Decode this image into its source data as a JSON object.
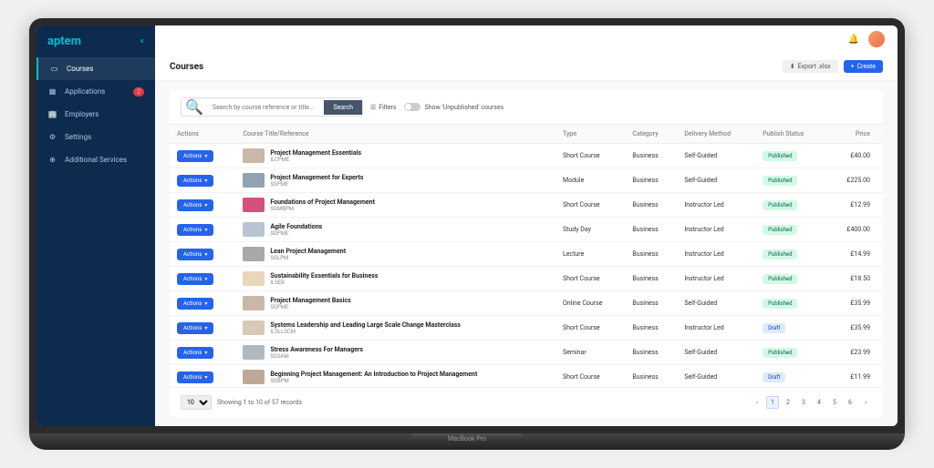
{
  "brand": "aptem",
  "sidebar": {
    "items": [
      {
        "label": "Courses",
        "active": true
      },
      {
        "label": "Applications",
        "badge": "2"
      },
      {
        "label": "Employers"
      },
      {
        "label": "Settings"
      },
      {
        "label": "Additional Services"
      }
    ]
  },
  "page": {
    "title": "Courses",
    "export_label": "Export .xlsx",
    "create_label": "Create"
  },
  "search": {
    "placeholder": "Search by course reference or title...",
    "button": "Search",
    "filters_label": "Filters",
    "toggle_label": "Show 'Unpublished' courses"
  },
  "table": {
    "headers": {
      "actions": "Actions",
      "title": "Course Title/Reference",
      "type": "Type",
      "category": "Category",
      "delivery": "Delivery Method",
      "status": "Publish Status",
      "price": "Price"
    },
    "action_btn": "Actions",
    "rows": [
      {
        "title": "Project Management Essentials",
        "ref": "ILCPME",
        "type": "Short Course",
        "category": "Business",
        "delivery": "Self-Guided",
        "status": "Published",
        "price": "£40.00",
        "thumb": "#c9b8a8"
      },
      {
        "title": "Project Management for Experts",
        "ref": "SGPME",
        "type": "Module",
        "category": "Business",
        "delivery": "Self-Guided",
        "status": "Published",
        "price": "£225.00",
        "thumb": "#8fa3b0"
      },
      {
        "title": "Foundations of Project Management",
        "ref": "SGMBPM",
        "type": "Short Course",
        "category": "Business",
        "delivery": "Instructor Led",
        "status": "Published",
        "price": "£12.99",
        "thumb": "#d4527a"
      },
      {
        "title": "Agile Foundations",
        "ref": "SGPME",
        "type": "Study Day",
        "category": "Business",
        "delivery": "Instructor Led",
        "status": "Published",
        "price": "£400.00",
        "thumb": "#b8c4d0"
      },
      {
        "title": "Lean Project Management",
        "ref": "SGLPM",
        "type": "Lecture",
        "category": "Business",
        "delivery": "Instructor Led",
        "status": "Published",
        "price": "£14.99",
        "thumb": "#a8a8a8"
      },
      {
        "title": "Sustainability Essentials for Business",
        "ref": "ILSEB",
        "type": "Short Course",
        "category": "Business",
        "delivery": "Instructor Led",
        "status": "Published",
        "price": "£18.50",
        "thumb": "#e8d8b8"
      },
      {
        "title": "Project Management Basics",
        "ref": "SGPME",
        "type": "Online Course",
        "category": "Business",
        "delivery": "Self-Guided",
        "status": "Published",
        "price": "£35.99",
        "thumb": "#c8b8a8"
      },
      {
        "title": "Systems Leadership and Leading Large Scale Change Masterclass",
        "ref": "ILSLLSCM",
        "type": "Short Course",
        "category": "Business",
        "delivery": "Instructor Led",
        "status": "Draft",
        "price": "£35.99",
        "thumb": "#d8c8b8"
      },
      {
        "title": "Stress Awareness For Managers",
        "ref": "SGSAM",
        "type": "Seminar",
        "category": "Business",
        "delivery": "Self-Guided",
        "status": "Published",
        "price": "£23.99",
        "thumb": "#b0b8c0"
      },
      {
        "title": "Beginning Project Management: An Introduction to Project Management",
        "ref": "SGBPM",
        "type": "Short Course",
        "category": "Business",
        "delivery": "Self-Guided",
        "status": "Draft",
        "price": "£11.99",
        "thumb": "#c0a898"
      }
    ]
  },
  "pagination": {
    "page_size": "10",
    "summary": "Showing 1 to 10 of 57 records",
    "pages": [
      "1",
      "2",
      "3",
      "4",
      "5",
      "6"
    ],
    "current": "1"
  },
  "laptop_label": "MacBook Pro"
}
